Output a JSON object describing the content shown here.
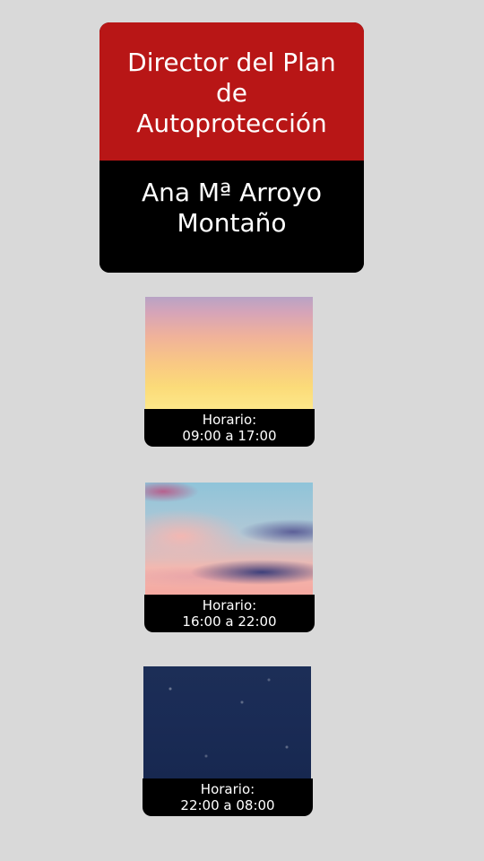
{
  "role_card": {
    "title": "Director del Plan de Autoprotección",
    "name": "Ana Mª Arroyo Montaño",
    "header_color": "#b81616",
    "body_color": "#000000"
  },
  "shifts": [
    {
      "image": "sunrise-sky",
      "label": "Horario:",
      "hours": "09:00 a 17:00"
    },
    {
      "image": "sunset-clouds-sky",
      "label": "Horario:",
      "hours": "16:00 a 22:00"
    },
    {
      "image": "night-sky",
      "label": "Horario:",
      "hours": "22:00 a 08:00"
    }
  ],
  "page_background": "#d9d9d9"
}
